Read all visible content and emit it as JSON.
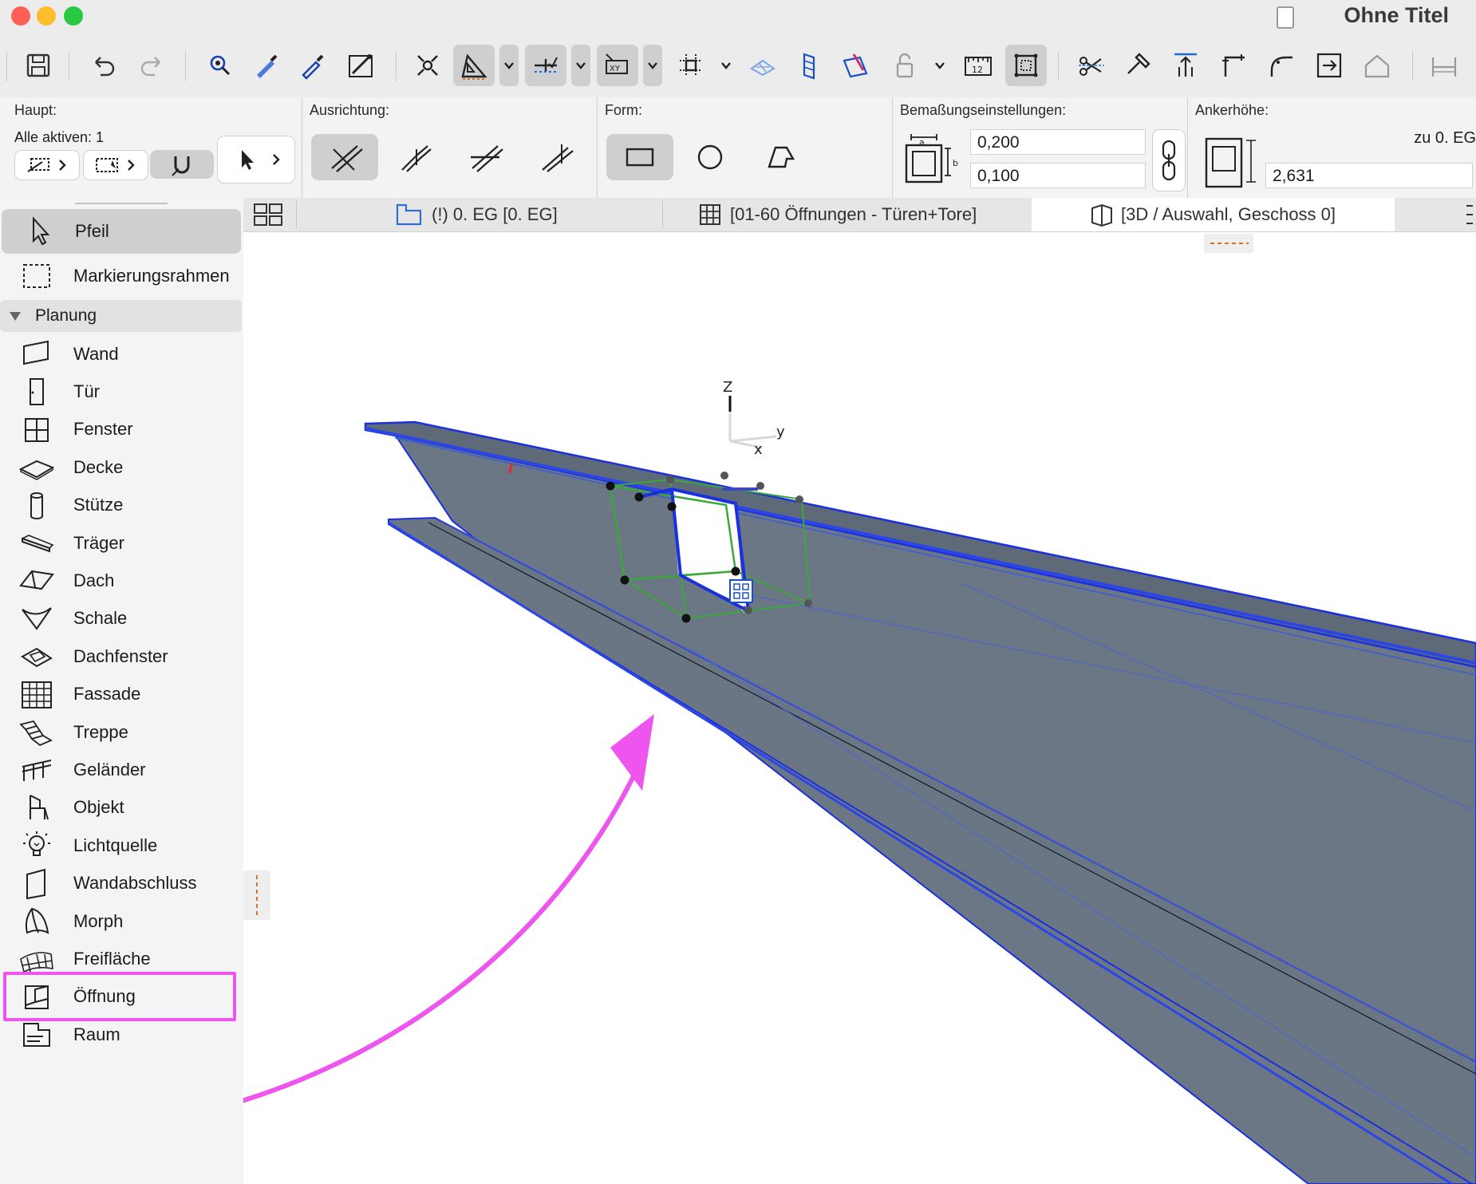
{
  "window": {
    "title": "Ohne Titel"
  },
  "toolbar": {
    "icons": [
      "save-icon",
      "undo-icon",
      "redo-icon",
      "find-select-icon",
      "pick-up-parameters-icon",
      "inject-parameters-icon",
      "magic-wand-icon",
      "suspend-groups-icon",
      "guide-lines-icon",
      "snap-guides-icon",
      "coordinates-xy-icon",
      "grid-snap-icon",
      "trace-icon",
      "layer-icon",
      "renovation-icon",
      "lock-icon",
      "measure-icon",
      "fit-in-window-icon",
      "split-icon",
      "adjust-icon",
      "elevate-icon",
      "fillet-icon",
      "curve-icon",
      "offset-icon",
      "roof-icon",
      "dimension-icon"
    ]
  },
  "infobox": {
    "haupt_label": "Haupt:",
    "alle_aktiven": "Alle aktiven: 1",
    "ausrichtung_label": "Ausrichtung:",
    "form_label": "Form:",
    "bemassung_label": "Bemaßungseinstellungen:",
    "bemassung_a": "0,200",
    "bemassung_b": "0,100",
    "anker_label": "Ankerhöhe:",
    "anker_ref": "zu 0. EG",
    "anker_value": "2,631",
    "selected_form": "rectangle"
  },
  "sidebar": {
    "tools": [
      {
        "label": "Pfeil",
        "icon": "arrow-icon",
        "selected": true
      },
      {
        "label": "Markierungsrahmen",
        "icon": "marquee-icon",
        "selected": false
      }
    ],
    "category": "Planung",
    "items": [
      {
        "label": "Wand",
        "icon": "wall-icon"
      },
      {
        "label": "Tür",
        "icon": "door-icon"
      },
      {
        "label": "Fenster",
        "icon": "window-icon"
      },
      {
        "label": "Decke",
        "icon": "slab-icon"
      },
      {
        "label": "Stütze",
        "icon": "column-icon"
      },
      {
        "label": "Träger",
        "icon": "beam-icon"
      },
      {
        "label": "Dach",
        "icon": "roof-icon"
      },
      {
        "label": "Schale",
        "icon": "shell-icon"
      },
      {
        "label": "Dachfenster",
        "icon": "skylight-icon"
      },
      {
        "label": "Fassade",
        "icon": "curtain-wall-icon"
      },
      {
        "label": "Treppe",
        "icon": "stair-icon"
      },
      {
        "label": "Geländer",
        "icon": "railing-icon"
      },
      {
        "label": "Objekt",
        "icon": "object-icon"
      },
      {
        "label": "Lichtquelle",
        "icon": "lamp-icon"
      },
      {
        "label": "Wandabschluss",
        "icon": "wall-end-icon"
      },
      {
        "label": "Morph",
        "icon": "morph-icon"
      },
      {
        "label": "Freifläche",
        "icon": "mesh-icon"
      },
      {
        "label": "Öffnung",
        "icon": "opening-icon"
      },
      {
        "label": "Raum",
        "icon": "zone-icon"
      }
    ]
  },
  "tabs": [
    {
      "label": "(!) 0. EG [0. EG]",
      "icon": "floor-plan-icon",
      "active": false
    },
    {
      "label": "[01-60 Öffnungen - Türen+Tore]",
      "icon": "schedule-icon",
      "active": false
    },
    {
      "label": "[3D / Auswahl, Geschoss 0]",
      "icon": "3d-icon",
      "active": true
    }
  ],
  "viewport": {
    "axis_labels": {
      "z": "Z",
      "y": "y",
      "x": "x"
    }
  },
  "colors": {
    "annotation": "#ee55ee",
    "selection_blue": "#1a2fe0",
    "edit_green": "#3aa83a",
    "beam_gray": "#6b7784"
  }
}
